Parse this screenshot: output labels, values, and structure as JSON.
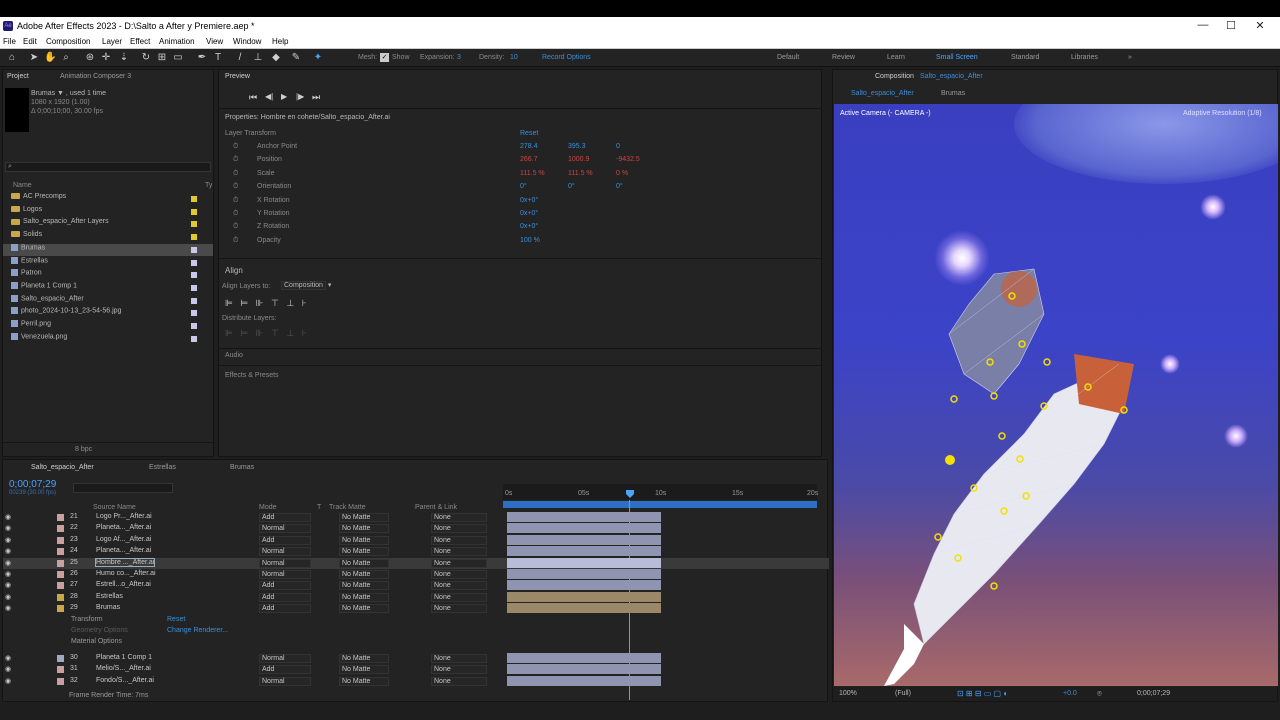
{
  "app": {
    "title": "Adobe After Effects 2023 - D:\\Salto a After y Premiere.aep *",
    "logo": "Ae",
    "win_controls": [
      "—",
      "☐",
      "✕"
    ]
  },
  "menu": [
    "File",
    "Edit",
    "Composition",
    "Layer",
    "Effect",
    "Animation",
    "View",
    "Window",
    "Help"
  ],
  "toolbar": {
    "mesh": "Mesh:",
    "show": "Show",
    "expansion": "Expansion:",
    "expansion_val": "3",
    "density": "Density:",
    "density_val": "10",
    "record": "Record Options",
    "workspaces": [
      "Default",
      "Review",
      "Learn",
      "Small Screen",
      "Standard",
      "Libraries"
    ],
    "more": "»"
  },
  "project": {
    "tabs": [
      "Project",
      "Animation Composer 3"
    ],
    "selected_name": "Brumas ▼ , used 1 time",
    "dims": "1080 x 1920 (1.00)",
    "duration": "Δ 0;00;10;00, 30.00 fps",
    "search_placeholder": "",
    "col_name": "Name",
    "col_type": "Ty",
    "items": [
      {
        "name": "AC Precomps",
        "kind": "folder"
      },
      {
        "name": "Logos",
        "kind": "folder"
      },
      {
        "name": "Salto_espacio_After Layers",
        "kind": "folder"
      },
      {
        "name": "Solids",
        "kind": "folder"
      },
      {
        "name": "Brumas",
        "kind": "comp"
      },
      {
        "name": "Estrellas",
        "kind": "comp"
      },
      {
        "name": "Patron",
        "kind": "comp"
      },
      {
        "name": "Planeta 1 Comp 1",
        "kind": "comp"
      },
      {
        "name": "Salto_espacio_After",
        "kind": "comp"
      },
      {
        "name": "photo_2024-10-13_23-54-56.jpg",
        "kind": "file"
      },
      {
        "name": "Perril.png",
        "kind": "file"
      },
      {
        "name": "Venezuela.png",
        "kind": "file"
      }
    ],
    "bpc": "8 bpc"
  },
  "preview": {
    "title": "Preview",
    "buttons": [
      "⏮",
      "◀|",
      "▶",
      "|▶",
      "⏭"
    ]
  },
  "properties": {
    "title": "Properties: Hombre en cohete/Salto_espacio_After.ai",
    "section": "Layer Transform",
    "reset": "Reset",
    "rows": [
      {
        "label": "Anchor Point",
        "v1": "278.4",
        "v2": "395.3",
        "v3": "0"
      },
      {
        "label": "Position",
        "v1": "266.7",
        "v2": "1000.9",
        "v3": "-9432.5"
      },
      {
        "label": "Scale",
        "v1": "111.5 %",
        "v2": "111.5 %",
        "v3": "0 %"
      },
      {
        "label": "Orientation",
        "v1": "0°",
        "v2": "0°",
        "v3": "0°"
      },
      {
        "label": "X Rotation",
        "v1": "0x+0°",
        "v2": "",
        "v3": ""
      },
      {
        "label": "Y Rotation",
        "v1": "0x+0°",
        "v2": "",
        "v3": ""
      },
      {
        "label": "Z Rotation",
        "v1": "0x+0°",
        "v2": "",
        "v3": ""
      },
      {
        "label": "Opacity",
        "v1": "100 %",
        "v2": "",
        "v3": ""
      }
    ]
  },
  "align": {
    "title": "Align",
    "align_to_label": "Align Layers to:",
    "align_to_val": "Composition",
    "distribute": "Distribute Layers:",
    "audio": "Audio",
    "effects": "Effects & Presets"
  },
  "timeline": {
    "tabs": [
      "Salto_espacio_After",
      "Estrellas",
      "Brumas"
    ],
    "timecode": "0;00;07;29",
    "frames": "00239 (30.00 fps)",
    "col_source": "Source Name",
    "col_mode": "Mode",
    "col_t": "T",
    "col_track": "Track Matte",
    "col_parent": "Parent & Link",
    "ruler": [
      "0s",
      "05s",
      "10s",
      "15s",
      "20s"
    ],
    "layers": [
      {
        "num": "21",
        "name": "Logo Pr..._After.ai",
        "mode": "Add",
        "matte": "No Matte",
        "parent": "None",
        "color": "#c8a0a0"
      },
      {
        "num": "22",
        "name": "Planeta..._After.ai",
        "mode": "Normal",
        "matte": "No Matte",
        "parent": "None",
        "color": "#c8a0a0"
      },
      {
        "num": "23",
        "name": "Logo Af..._After.ai",
        "mode": "Add",
        "matte": "No Matte",
        "parent": "None",
        "color": "#c8a0a0"
      },
      {
        "num": "24",
        "name": "Planeta..._After.ai",
        "mode": "Normal",
        "matte": "No Matte",
        "parent": "None",
        "color": "#c8a0a0"
      },
      {
        "num": "25",
        "name": "Hombre ..._After.ai",
        "mode": "Normal",
        "matte": "No Matte",
        "parent": "None",
        "color": "#c8a0a0"
      },
      {
        "num": "26",
        "name": "Humo co..._After.ai",
        "mode": "Normal",
        "matte": "No Matte",
        "parent": "None",
        "color": "#c8a0a0"
      },
      {
        "num": "27",
        "name": "Estrell...o_After.ai",
        "mode": "Add",
        "matte": "No Matte",
        "parent": "None",
        "color": "#c8a0a0"
      },
      {
        "num": "28",
        "name": "Estrellas",
        "mode": "Add",
        "matte": "No Matte",
        "parent": "None",
        "color": "#c8a84a"
      },
      {
        "num": "29",
        "name": "Brumas",
        "mode": "Add",
        "matte": "No Matte",
        "parent": "None",
        "color": "#c8a84a"
      }
    ],
    "sub": [
      {
        "label": "Transform",
        "value": "Reset"
      },
      {
        "label": "Geometry Options",
        "value": "Change Renderer..."
      },
      {
        "label": "Material Options",
        "value": ""
      }
    ],
    "layers2": [
      {
        "num": "30",
        "name": "Planeta 1 Comp 1",
        "mode": "Normal",
        "matte": "No Matte",
        "parent": "None",
        "color": "#a0a8c8"
      },
      {
        "num": "31",
        "name": "Melio/S..._After.ai",
        "mode": "Add",
        "matte": "No Matte",
        "parent": "None",
        "color": "#c8a0a0"
      },
      {
        "num": "32",
        "name": "Fondo/S..._After.ai",
        "mode": "Normal",
        "matte": "No Matte",
        "parent": "None",
        "color": "#c8a0a0"
      }
    ],
    "render_time": "Frame Render Time: 7ms"
  },
  "composition": {
    "title": "Composition",
    "comp_name": "Salto_espacio_After",
    "subtabs": [
      "Salto_espacio_After",
      "Brumas"
    ],
    "camera": "Active Camera (- CAMERA -)",
    "resolution": "Adaptive Resolution (1/8)",
    "zoom": "100%",
    "quality": "(Full)",
    "exposure": "+0.0",
    "time": "0;00;07;29"
  },
  "colors": {
    "accent": "#2d8ceb",
    "panel": "#232323"
  }
}
